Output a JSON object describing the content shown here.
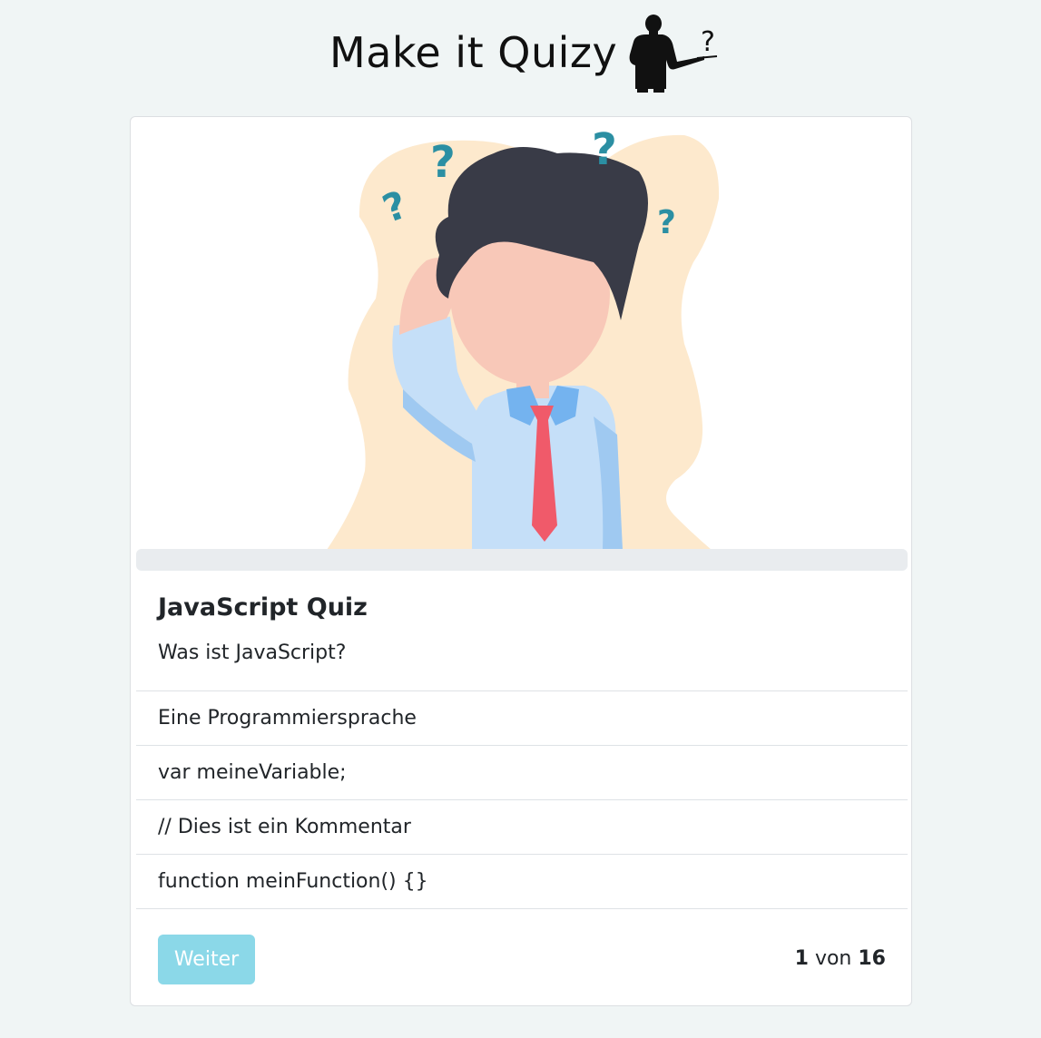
{
  "header": {
    "title": "Make it Quizy",
    "logo_icon": "quiz-presenter-icon",
    "logo_mark": "?"
  },
  "illustration": {
    "icon": "thinking-man-illustration",
    "colors": {
      "blob": "#fde9cd",
      "hair": "#393b47",
      "skin": "#f8c8b8",
      "shirt": "#c5dff8",
      "collar": "#74b3ef",
      "tie": "#f05a6a",
      "question_marks": "#2b8fa3"
    },
    "question_mark": "?"
  },
  "progress": {
    "value": 0
  },
  "quiz": {
    "title": "JavaScript Quiz",
    "question": "Was ist JavaScript?",
    "answers": [
      {
        "label": "Eine Programmiersprache"
      },
      {
        "label": "var meineVariable;"
      },
      {
        "label": "// Dies ist ein Kommentar"
      },
      {
        "label": "function meinFunction() {}"
      }
    ]
  },
  "footer": {
    "next_label": "Weiter",
    "current": "1",
    "separator": "von",
    "total": "16",
    "colors": {
      "button": "#8bd8e8"
    }
  }
}
